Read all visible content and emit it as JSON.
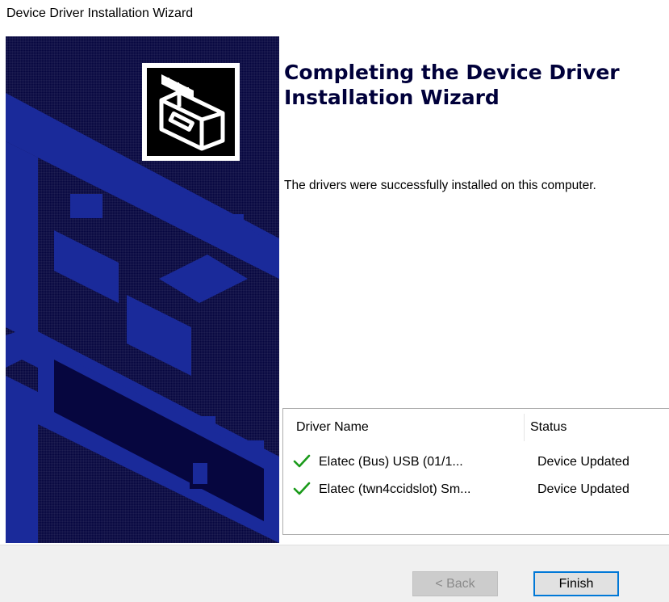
{
  "window": {
    "title": "Device Driver Installation Wizard"
  },
  "main": {
    "heading_line1": "Completing the Device Driver",
    "heading_line2": "Installation Wizard",
    "message": "The drivers were successfully installed on this computer."
  },
  "table": {
    "columns": {
      "name": "Driver Name",
      "status": "Status"
    },
    "rows": [
      {
        "name": "Elatec (Bus) USB  (01/1...",
        "status": "Device Updated",
        "icon": "check-icon"
      },
      {
        "name": "Elatec (twn4ccidslot) Sm...",
        "status": "Device Updated",
        "icon": "check-icon"
      }
    ]
  },
  "buttons": {
    "back": "< Back",
    "finish": "Finish"
  },
  "colors": {
    "banner_bg": "#06063f",
    "banner_shape": "#1a2a9a",
    "heading": "#00003a",
    "check": "#1a9a1a",
    "focus_border": "#0078d7"
  }
}
